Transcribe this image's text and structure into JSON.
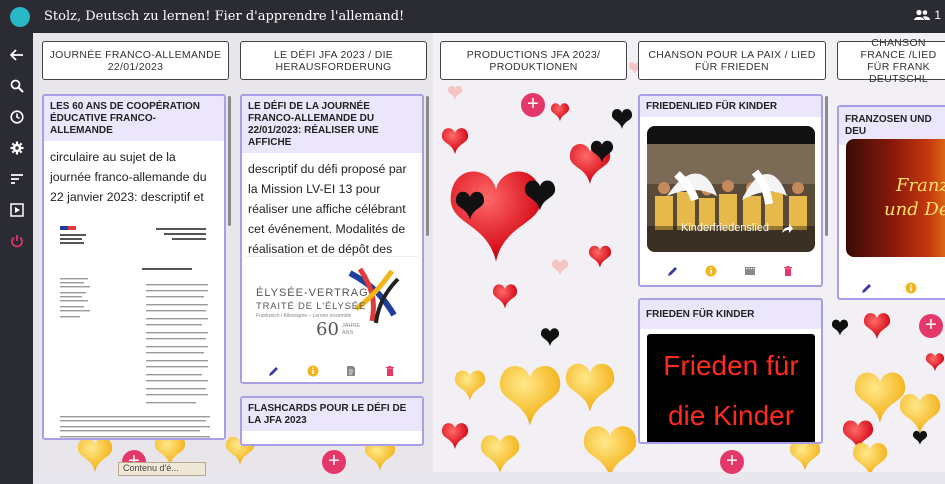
{
  "app": {
    "title": "Stolz, Deutsch zu lernen! Fier d'apprendre l'allemand!",
    "members_count": "1"
  },
  "columns": [
    {
      "header": "JOURNÉE FRANCO-ALLEMANDE 22/01/2023"
    },
    {
      "header": "LE DÉFI JFA 2023 / DIE HERAUSFORDERUNG"
    },
    {
      "header": "PRODUCTIONS JFA 2023/ PRODUKTIONEN"
    },
    {
      "header": "CHANSON POUR LA PAIX / LIED FÜR FRIEDEN"
    },
    {
      "header": "CHANSON FRANCE /LIED FÜR FRANK DEUTSCHL"
    }
  ],
  "cards": {
    "c1": {
      "title": "LES 60 ANS DE COOPÉRATION ÉDUCATIVE FRANCO-ALLEMANDE",
      "text": "circulaire au sujet de la journée franco-allemande du 22 janvier 2023: descriptif et enjeux"
    },
    "c2": {
      "title": "LE DÉFI DE LA JOURNÉE FRANCO-ALLEMANDE DU 22/01/2023: RÉALISER UNE AFFICHE",
      "text": "descriptif du défi proposé par la Mission LV-EI 13 pour réaliser une affiche célébrant cet événement. Modalités de réalisation et de dépôt des productions",
      "logo_line1": "ÉLYSÉE-VERTRAG",
      "logo_line2": "TRAITÉ DE L'ÉLYSÉE",
      "logo_small": "Frankreich / Allemagne – Lernen ensemble",
      "logo_years": "60",
      "logo_years_label": "JAHRE ANS"
    },
    "c3": {
      "title": "FLASHCARDS POUR LE DÉFI DE LA JFA 2023"
    },
    "c4": {
      "title": "FRIEDENLIED FÜR KINDER",
      "video_caption": "Kinderfriedenslied"
    },
    "c5": {
      "title": "FRIEDEN FÜR KINDER",
      "poster_line1": "Frieden für",
      "poster_line2": "die Kinder"
    },
    "c6": {
      "title": "FRANZOSEN UND DEU",
      "thumb_line1": "Franzo",
      "thumb_line2": "und Deu"
    }
  },
  "tooltip": {
    "text": "Contenu d'é..."
  },
  "colors": {
    "topbar": "#2b2b33",
    "accent_pink": "#e5386a",
    "card_border": "#a99fe6",
    "card_title_bg": "#ebe6fb"
  }
}
